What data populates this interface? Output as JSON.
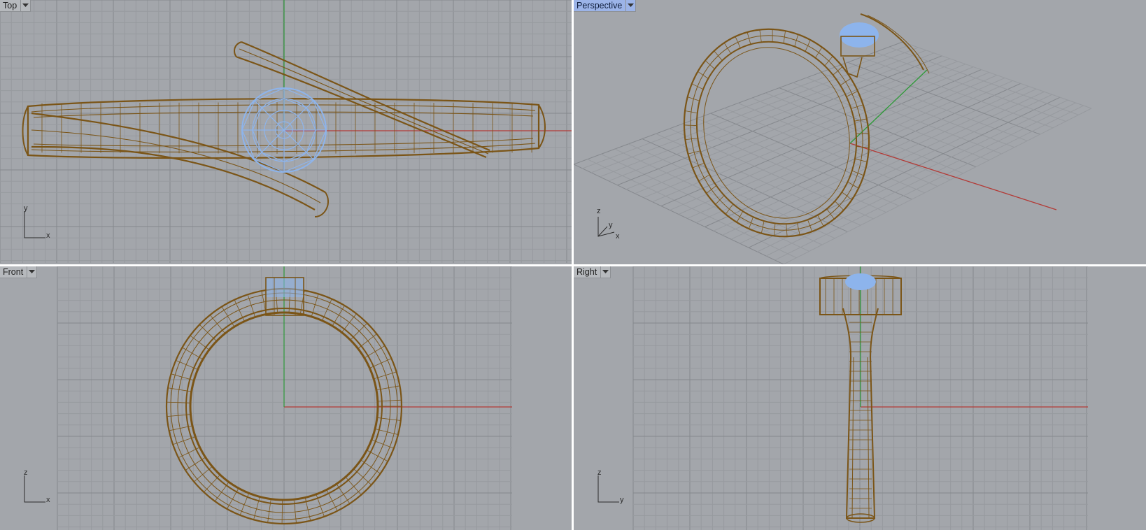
{
  "colors": {
    "viewport_bg": "#a3a6ab",
    "grid_minor": "#979a9f",
    "grid_major": "#85888d",
    "x_axis": "#b33a36",
    "y_axis": "#2e9a38",
    "wire": "#7b5517",
    "gem": "#8db4ec",
    "active_tab": "#9cb4e8"
  },
  "viewports": {
    "top": {
      "label": "Top",
      "axis_a": "y",
      "axis_b": "x",
      "dropdown_icon": "chevron-down-icon"
    },
    "persp": {
      "label": "Perspective",
      "axis_a": "z",
      "axis_b": "y",
      "axis_c": "x",
      "active": true,
      "dropdown_icon": "chevron-down-icon"
    },
    "front": {
      "label": "Front",
      "axis_a": "z",
      "axis_b": "x",
      "dropdown_icon": "chevron-down-icon"
    },
    "right": {
      "label": "Right",
      "axis_a": "z",
      "axis_b": "y",
      "dropdown_icon": "chevron-down-icon"
    }
  }
}
